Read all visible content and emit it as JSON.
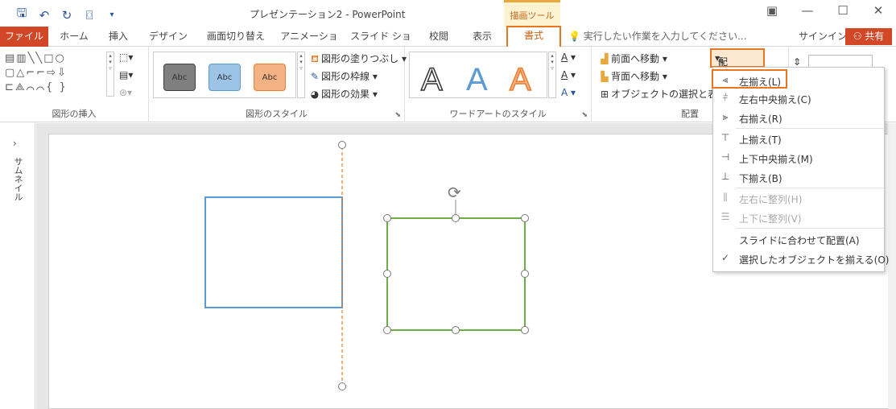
{
  "window": {
    "title": "プレゼンテーション2 - PowerPoint",
    "context_tab_header": "描画ツール",
    "controls": [
      "ribbon-display",
      "minimize",
      "maximize",
      "close"
    ]
  },
  "quick_access": [
    "save",
    "undo",
    "redo",
    "present",
    "customize"
  ],
  "tabs": [
    {
      "label": "ファイル"
    },
    {
      "label": "ホーム"
    },
    {
      "label": "挿入"
    },
    {
      "label": "デザイン"
    },
    {
      "label": "画面切り替え"
    },
    {
      "label": "アニメーション"
    },
    {
      "label": "スライド ショー"
    },
    {
      "label": "校閲"
    },
    {
      "label": "表示"
    },
    {
      "label": "書式"
    }
  ],
  "tell_me": "実行したい作業を入力してください...",
  "signin": "サインイン",
  "share": "共有",
  "ribbon": {
    "insert_shapes": {
      "label": "図形の挿入"
    },
    "shape_styles": {
      "label": "図形のスタイル",
      "abc": "Abc",
      "fill": "図形の塗りつぶし",
      "outline": "図形の枠線",
      "effects": "図形の効果"
    },
    "wordart": {
      "label": "ワードアートのスタイル",
      "letter": "A"
    },
    "arrange": {
      "label": "配置",
      "bring_forward": "前面へ移動",
      "send_backward": "背面へ移動",
      "selection_pane": "オブジェクトの選択と表示",
      "align": "配置"
    }
  },
  "thumbnail_pane": {
    "label": "サムネイル"
  },
  "align_menu": [
    {
      "label": "左揃え(L)",
      "icon": "align-left-icon",
      "disabled": false,
      "highlight": true
    },
    {
      "label": "左右中央揃え(C)",
      "icon": "align-center-icon",
      "disabled": false
    },
    {
      "label": "右揃え(R)",
      "icon": "align-right-icon",
      "disabled": false
    },
    {
      "label": "上揃え(T)",
      "icon": "align-top-icon",
      "disabled": false
    },
    {
      "label": "上下中央揃え(M)",
      "icon": "align-middle-icon",
      "disabled": false
    },
    {
      "label": "下揃え(B)",
      "icon": "align-bottom-icon",
      "disabled": false
    },
    {
      "label": "左右に整列(H)",
      "icon": "distribute-horizontal-icon",
      "disabled": true
    },
    {
      "label": "上下に整列(V)",
      "icon": "distribute-vertical-icon",
      "disabled": true
    },
    {
      "label": "スライドに合わせて配置(A)",
      "icon": "",
      "disabled": false
    },
    {
      "label": "選択したオブジェクトを揃える(O)",
      "icon": "checkmark-icon",
      "disabled": false,
      "checked": true
    }
  ],
  "colors": {
    "accent_orange": "#e87722",
    "file_tab": "#d24726",
    "blue_rect": "#5b9bd5",
    "green_rect": "#70ad47"
  }
}
